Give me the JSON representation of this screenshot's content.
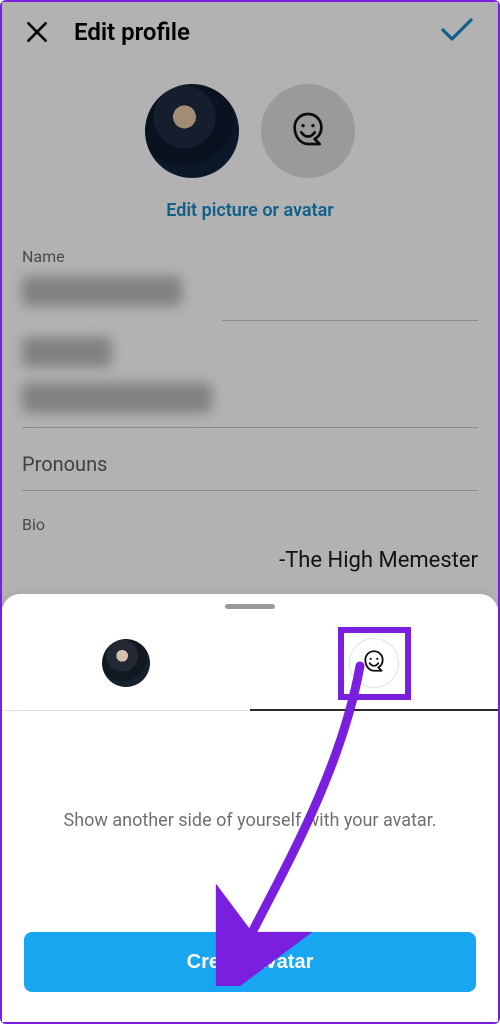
{
  "header": {
    "title": "Edit profile"
  },
  "edit_picture_link": "Edit picture or avatar",
  "fields": {
    "name_label": "Name",
    "pronouns_label": "Pronouns",
    "bio_label": "Bio",
    "bio_value": "-The High Memester"
  },
  "sheet": {
    "prompt_text": "Show another side of yourself with your avatar.",
    "create_button": "Create avatar"
  },
  "colors": {
    "accent": "#18a6f0",
    "link": "#1a8ac5",
    "annotation": "#7a1fe0"
  }
}
